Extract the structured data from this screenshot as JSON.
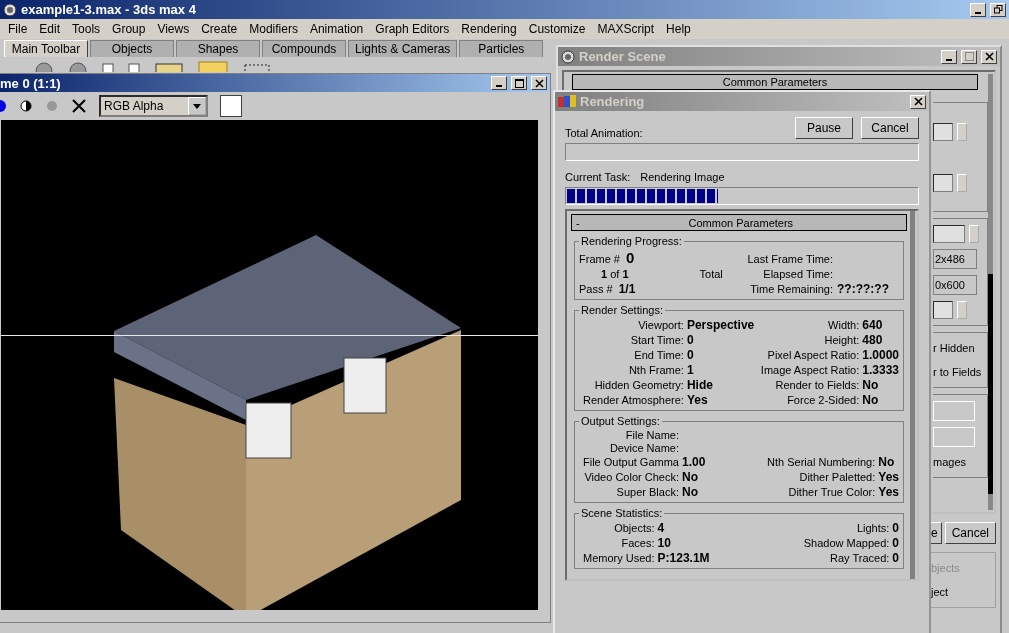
{
  "app": {
    "title": "example1-3.max - 3ds max 4",
    "menu": [
      "File",
      "Edit",
      "Tools",
      "Group",
      "Views",
      "Create",
      "Modifiers",
      "Animation",
      "Graph Editors",
      "Rendering",
      "Customize",
      "MAXScript",
      "Help"
    ],
    "tabs": [
      {
        "label": "Main Toolbar",
        "selected": true
      },
      {
        "label": "Objects",
        "selected": false
      },
      {
        "label": "Shapes",
        "selected": false
      },
      {
        "label": "Compounds",
        "selected": false
      },
      {
        "label": "Lights & Cameras",
        "selected": false
      },
      {
        "label": "Particles",
        "selected": false
      }
    ]
  },
  "frame_window": {
    "title": "me 0 (1:1)",
    "channel": "RGB Alpha"
  },
  "render_scene": {
    "title": "Render Scene",
    "rollout": "Common Parameters",
    "presets": [
      "2x486",
      "0x600"
    ],
    "options": [
      "r Hidden",
      "r to Fields"
    ],
    "output_label": "mages",
    "buttons": [
      "e",
      "Cancel"
    ],
    "choices": [
      {
        "label": "bjects",
        "disabled": true
      },
      {
        "label": "ject",
        "disabled": false
      }
    ]
  },
  "rendering": {
    "title": "Rendering",
    "buttons": [
      "Pause",
      "Cancel"
    ],
    "total_animation": {
      "label": "Total Animation:",
      "level": 0
    },
    "current_task": {
      "label": "Current Task:",
      "value": "Rendering Image",
      "level": 0.43
    },
    "rollout": {
      "collapse": "-",
      "title": "Common Parameters"
    },
    "groups": [
      {
        "kind": "progress",
        "title": "Rendering Progress:",
        "frame_label": "Frame #",
        "frame": "0",
        "count": "**1** of **1**",
        "total": "Total",
        "pass_label": "Pass #",
        "pass": "1/1",
        "times": [
          {
            "label": "Last Frame Time:"
          },
          {
            "label": "Elapsed Time:"
          },
          {
            "label": "Time Remaining:",
            "value": "??:??:??"
          }
        ]
      },
      {
        "kind": "fields",
        "title": "Render Settings:",
        "rows": [
          [
            {
              "label": "Viewport:",
              "value": "Perspective"
            },
            {
              "label": "Width:",
              "value": "640"
            }
          ],
          [
            {
              "label": "Start Time:",
              "value": "0"
            },
            {
              "label": "Height:",
              "value": "480"
            }
          ],
          [
            {
              "label": "End Time:",
              "value": "0"
            },
            {
              "label": "Pixel Aspect Ratio:",
              "value": "1.0000"
            }
          ],
          [
            {
              "label": "Nth Frame:",
              "value": "1"
            },
            {
              "label": "Image Aspect Ratio:",
              "value": "1.3333"
            }
          ],
          [
            {
              "label": "Hidden Geometry:",
              "value": "Hide"
            },
            {
              "label": "Render to Fields:",
              "value": "No"
            }
          ],
          [
            {
              "label": "Render Atmosphere:",
              "value": "Yes"
            },
            {
              "label": "Force 2-Sided:",
              "value": "No"
            }
          ]
        ]
      },
      {
        "kind": "fields",
        "title": "Output Settings:",
        "rows": [
          [
            {
              "label": "File Name:"
            }
          ],
          [
            {
              "label": "Device Name:"
            }
          ],
          [
            {
              "label": "File Output Gamma",
              "value": "1.00"
            },
            {
              "label": "Nth Serial Numbering:",
              "value": "No"
            }
          ],
          [
            {
              "label": "Video Color Check:",
              "value": "No"
            },
            {
              "label": "Dither Paletted:",
              "value": "Yes"
            }
          ],
          [
            {
              "label": "Super Black:",
              "value": "No"
            },
            {
              "label": "Dither True Color:",
              "value": "Yes"
            }
          ]
        ]
      },
      {
        "kind": "fields",
        "title": "Scene Statistics:",
        "rows": [
          [
            {
              "label": "Objects:",
              "value": "4"
            },
            {
              "label": "Lights:",
              "value": "0"
            }
          ],
          [
            {
              "label": "Faces:",
              "value": "10"
            },
            {
              "label": "Shadow Mapped:",
              "value": "0"
            }
          ],
          [
            {
              "label": "Memory Used:",
              "value": "P:123.1M"
            },
            {
              "label": "Ray Traced:",
              "value": "0"
            }
          ]
        ]
      }
    ]
  }
}
